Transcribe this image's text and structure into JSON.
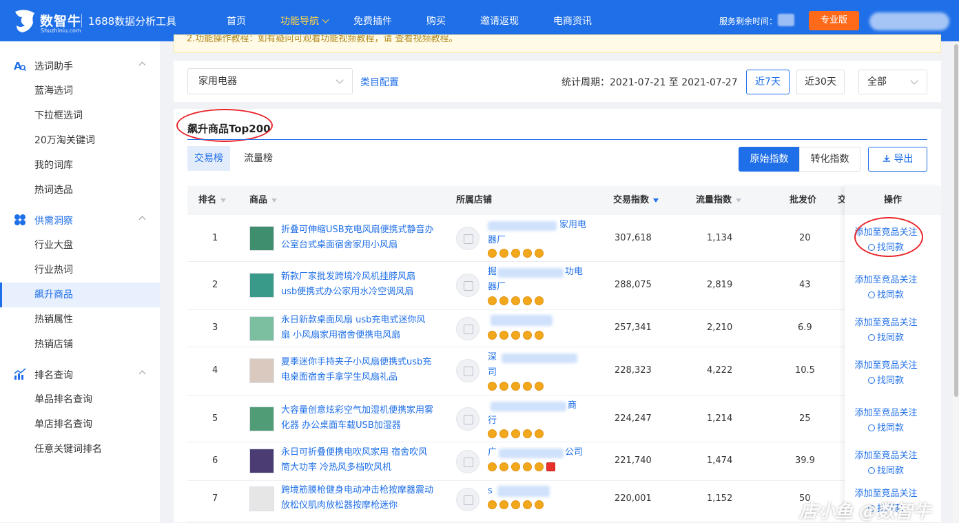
{
  "header": {
    "brand": "数智牛",
    "brand_sub": "Shuzhiniu.com",
    "tool_name": "1688数据分析工具",
    "nav": [
      "首页",
      "功能导航",
      "免费插件",
      "购买",
      "邀请返现",
      "电商资讯"
    ],
    "nav_active": "功能导航",
    "service_label": "服务剩余时间：",
    "pro_button": "专业版"
  },
  "sidebar": {
    "groups": [
      {
        "label": "选词助手",
        "icon": "search-doc-icon",
        "items": [
          "蓝海选词",
          "下拉框选词",
          "20万淘关键词",
          "我的词库",
          "热词选品"
        ]
      },
      {
        "label": "供需洞察",
        "icon": "clover-icon",
        "items": [
          "行业大盘",
          "行业热词",
          "飙升商品",
          "热销属性",
          "热销店铺"
        ]
      },
      {
        "label": "排名查询",
        "icon": "chart-rise-icon",
        "items": [
          "单品排名查询",
          "单店排名查询",
          "任意关键词排名"
        ]
      }
    ],
    "active_item": "飙升商品"
  },
  "notice": "2.功能操作教程：如有疑问可观看功能视频教程，请 查看视频教程。",
  "filter": {
    "category": "家用电器",
    "category_config": "类目配置",
    "period": "统计周期：2021-07-21 至 2021-07-27",
    "btn_7d": "近7天",
    "btn_30d": "近30天",
    "select_all": "全部"
  },
  "panel": {
    "title": "飙升商品Top200",
    "tab_trade": "交易榜",
    "tab_flow": "流量榜",
    "seg_raw": "原始指数",
    "seg_conv": "转化指数",
    "export": "导出"
  },
  "table": {
    "columns": [
      "排名",
      "商品",
      "所属店铺",
      "交易指数",
      "流量指数",
      "批发价",
      "交",
      "操作"
    ],
    "rows": [
      {
        "rank": "1",
        "product": "折叠可伸缩USB充电风扇便携式静音办公室台式桌面宿舍家用小风扇",
        "shop_line1": "家用电",
        "shop_line2": "器厂",
        "trade": "307,618",
        "flow": "1,134",
        "price": "20",
        "thumb": "#3f8f6e"
      },
      {
        "rank": "2",
        "product": "新款厂家批发跨境冷风机挂脖风扇 usb便携式办公家用水冷空调风扇",
        "shop_line1": "掘",
        "shop_line2": "器厂",
        "shop_tail": "功电",
        "trade": "288,075",
        "flow": "2,819",
        "price": "43",
        "thumb": "#3a9a8a"
      },
      {
        "rank": "3",
        "product": "永日新款桌面风扇 usb充电式迷你风扇 小风扇家用宿舍便携电风扇",
        "shop_line1": "",
        "shop_line2": "",
        "trade": "257,341",
        "flow": "2,210",
        "price": "6.9",
        "thumb": "#7bbfa0"
      },
      {
        "rank": "4",
        "product": "夏季迷你手持夹子小风扇便携式usb充电桌面宿舍手拿学生风扇礼品",
        "shop_line1": "深",
        "shop_line2": "司",
        "trade": "228,323",
        "flow": "4,222",
        "price": "10.5",
        "thumb": "#d9c9bf"
      },
      {
        "rank": "5",
        "product": "大容量创意炫彩空气加湿机便携家用雾化器 办公桌面车载USB加湿器",
        "shop_line1": "",
        "shop_line2": "行",
        "shop_tail": "商",
        "trade": "224,247",
        "flow": "1,214",
        "price": "25",
        "thumb": "#4f9c77"
      },
      {
        "rank": "6",
        "product": "永日可折叠便携电吹风家用 宿舍吹风筒大功率 冷热风多档吹风机",
        "shop_line1": "广",
        "shop_line2": "",
        "shop_tail": "公司",
        "trade": "221,740",
        "flow": "1,474",
        "price": "39.9",
        "thumb": "#4b3c73"
      },
      {
        "rank": "7",
        "product": "跨境筋膜枪健身电动冲击枪按摩器震动放松仪肌肉放松器按摩枪迷你",
        "shop_line1": "s",
        "shop_line2": "",
        "trade": "220,001",
        "flow": "1,152",
        "price": "50",
        "thumb": "#e6e6e6"
      }
    ],
    "op_add": "添加至竞品关注",
    "op_find": "找同款"
  },
  "watermark": "店小鱼 @数智牛",
  "colors": {
    "primary": "#1f6fe8",
    "accent": "#ffd54a",
    "pro": "#ff6a1a",
    "highlight_circle": "#e8262b"
  }
}
